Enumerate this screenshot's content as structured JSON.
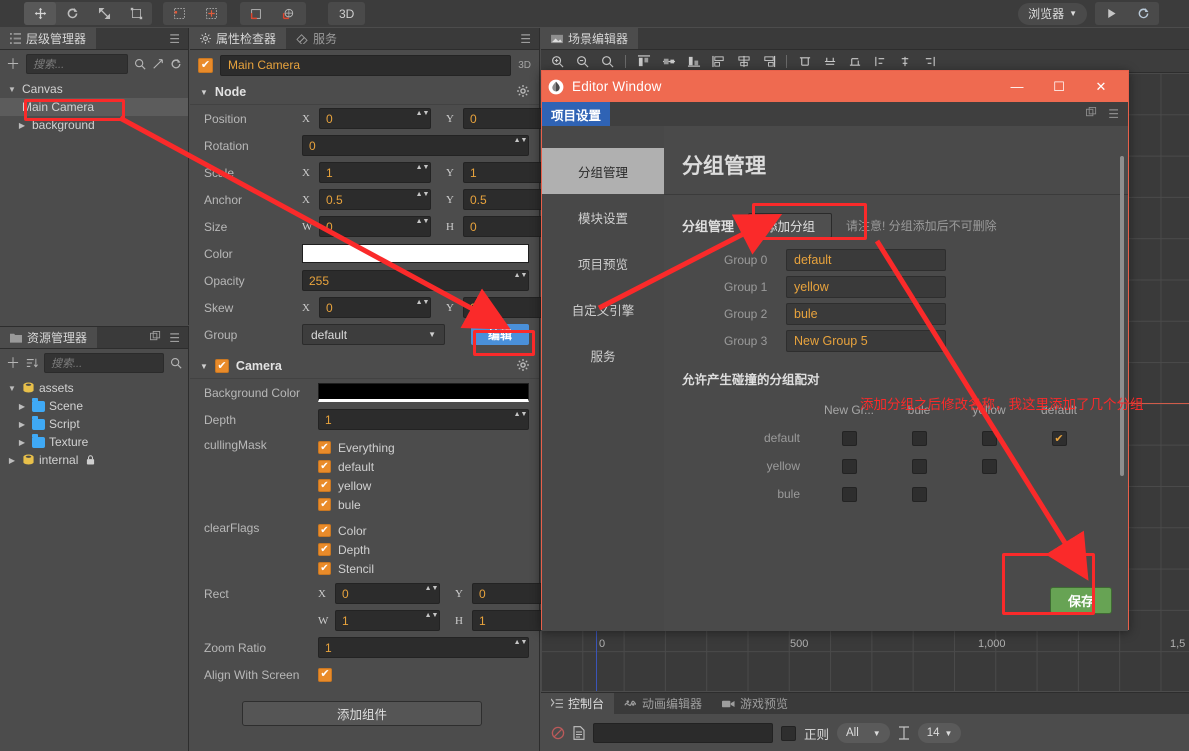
{
  "topbar": {
    "tools": [
      "move-tool",
      "rotate-tool",
      "scale-tool",
      "rect-tool"
    ],
    "tools2": [
      "grid-snap-tool",
      "pivot-tool"
    ],
    "tools3": [
      "local-coord-tool",
      "global-coord-tool"
    ],
    "mode_3d": "3D",
    "browser_label": "浏览器",
    "play_icon": "play-icon",
    "refresh_icon": "refresh-icon"
  },
  "hierarchy": {
    "tab": "层级管理器",
    "search_placeholder": "搜索...",
    "nodes": [
      {
        "label": "Canvas",
        "expanded": true,
        "depth": 0,
        "selected": false
      },
      {
        "label": "Main Camera",
        "expanded": false,
        "depth": 1,
        "selected": true
      },
      {
        "label": "background",
        "expanded": false,
        "depth": 1,
        "selected": false
      }
    ]
  },
  "assets": {
    "tab": "资源管理器",
    "search_placeholder": "搜索...",
    "nodes": [
      {
        "label": "assets",
        "depth": 0,
        "type": "db"
      },
      {
        "label": "Scene",
        "depth": 1,
        "type": "folder"
      },
      {
        "label": "Script",
        "depth": 1,
        "type": "folder"
      },
      {
        "label": "Texture",
        "depth": 1,
        "type": "folder"
      },
      {
        "label": "internal",
        "depth": 0,
        "type": "db",
        "locked": true
      }
    ]
  },
  "inspector": {
    "tabs": [
      "属性检查器",
      "服务"
    ],
    "active_tab": "属性检查器",
    "node_name": "Main Camera",
    "node_enabled": true,
    "badge_3d": "3D",
    "node_section": {
      "title": "Node",
      "position": {
        "label": "Position",
        "x_axis": "X",
        "x": "0",
        "y_axis": "Y",
        "y": "0"
      },
      "rotation": {
        "label": "Rotation",
        "value": "0"
      },
      "scale": {
        "label": "Scale",
        "x_axis": "X",
        "x": "1",
        "y_axis": "Y",
        "y": "1"
      },
      "anchor": {
        "label": "Anchor",
        "x_axis": "X",
        "x": "0.5",
        "y_axis": "Y",
        "y": "0.5"
      },
      "size": {
        "label": "Size",
        "w_axis": "W",
        "w": "0",
        "h_axis": "H",
        "h": "0"
      },
      "color": {
        "label": "Color",
        "value": "#ffffff"
      },
      "opacity": {
        "label": "Opacity",
        "value": "255"
      },
      "skew": {
        "label": "Skew",
        "x_axis": "X",
        "x": "0",
        "y_axis": "Y",
        "y": "0"
      },
      "group": {
        "label": "Group",
        "value": "default",
        "edit_button": "编辑"
      }
    },
    "camera_section": {
      "title": "Camera",
      "enabled": true,
      "background_color": {
        "label": "Background Color",
        "value": "#000000"
      },
      "depth": {
        "label": "Depth",
        "value": "1"
      },
      "culling_mask": {
        "label": "cullingMask",
        "items": [
          {
            "label": "Everything",
            "checked": true
          },
          {
            "label": "default",
            "checked": true
          },
          {
            "label": "yellow",
            "checked": true
          },
          {
            "label": "bule",
            "checked": true
          }
        ]
      },
      "clear_flags": {
        "label": "clearFlags",
        "items": [
          {
            "label": "Color",
            "checked": true
          },
          {
            "label": "Depth",
            "checked": true
          },
          {
            "label": "Stencil",
            "checked": true
          }
        ]
      },
      "rect": {
        "label": "Rect",
        "x_axis": "X",
        "x": "0",
        "y_axis": "Y",
        "y": "0",
        "w_axis": "W",
        "w": "1",
        "h_axis": "H",
        "h": "1"
      },
      "zoom_ratio": {
        "label": "Zoom Ratio",
        "value": "1"
      },
      "align_with_screen": {
        "label": "Align With Screen",
        "checked": true
      }
    },
    "add_component": "添加组件"
  },
  "scene": {
    "tab": "场景编辑器",
    "ruler_labels": [
      "0",
      "500",
      "1,000",
      "1,5"
    ]
  },
  "console": {
    "tabs": [
      "控制台",
      "动画编辑器",
      "游戏预览"
    ],
    "active_tab": "控制台",
    "filter_value": "",
    "regex_label": "正则",
    "level_value": "All",
    "font_size_value": "14"
  },
  "dialog": {
    "title": "Editor Window",
    "window_buttons": {
      "minimize": "minimize-icon",
      "maximize": "maximize-icon",
      "close": "close-icon"
    },
    "tab": "项目设置",
    "sidebar": [
      {
        "label": "分组管理",
        "active": true
      },
      {
        "label": "模块设置",
        "active": false
      },
      {
        "label": "项目预览",
        "active": false
      },
      {
        "label": "自定义引擎",
        "active": false
      },
      {
        "label": "服务",
        "active": false
      }
    ],
    "page_title": "分组管理",
    "group_section": {
      "label": "分组管理",
      "add_button": "添加分组",
      "warning": "请注意! 分组添加后不可删除",
      "groups": [
        {
          "label": "Group 0",
          "value": "default"
        },
        {
          "label": "Group 1",
          "value": "yellow"
        },
        {
          "label": "Group 2",
          "value": "bule"
        },
        {
          "label": "Group 3",
          "value": "New Group 5"
        }
      ]
    },
    "matrix": {
      "title": "允许产生碰撞的分组配对",
      "columns": [
        "New Gr...",
        "bule",
        "yellow",
        "default"
      ],
      "rows": [
        {
          "label": "default",
          "cells": [
            false,
            false,
            false,
            true
          ]
        },
        {
          "label": "yellow",
          "cells": [
            false,
            false,
            false,
            null
          ]
        },
        {
          "label": "bule",
          "cells": [
            false,
            false,
            null,
            null
          ]
        }
      ]
    },
    "save_button": "保存"
  },
  "annotations": {
    "note": "添加分组之后修改名称，我这里添加了几个分组",
    "color": "#fa2a2a"
  }
}
